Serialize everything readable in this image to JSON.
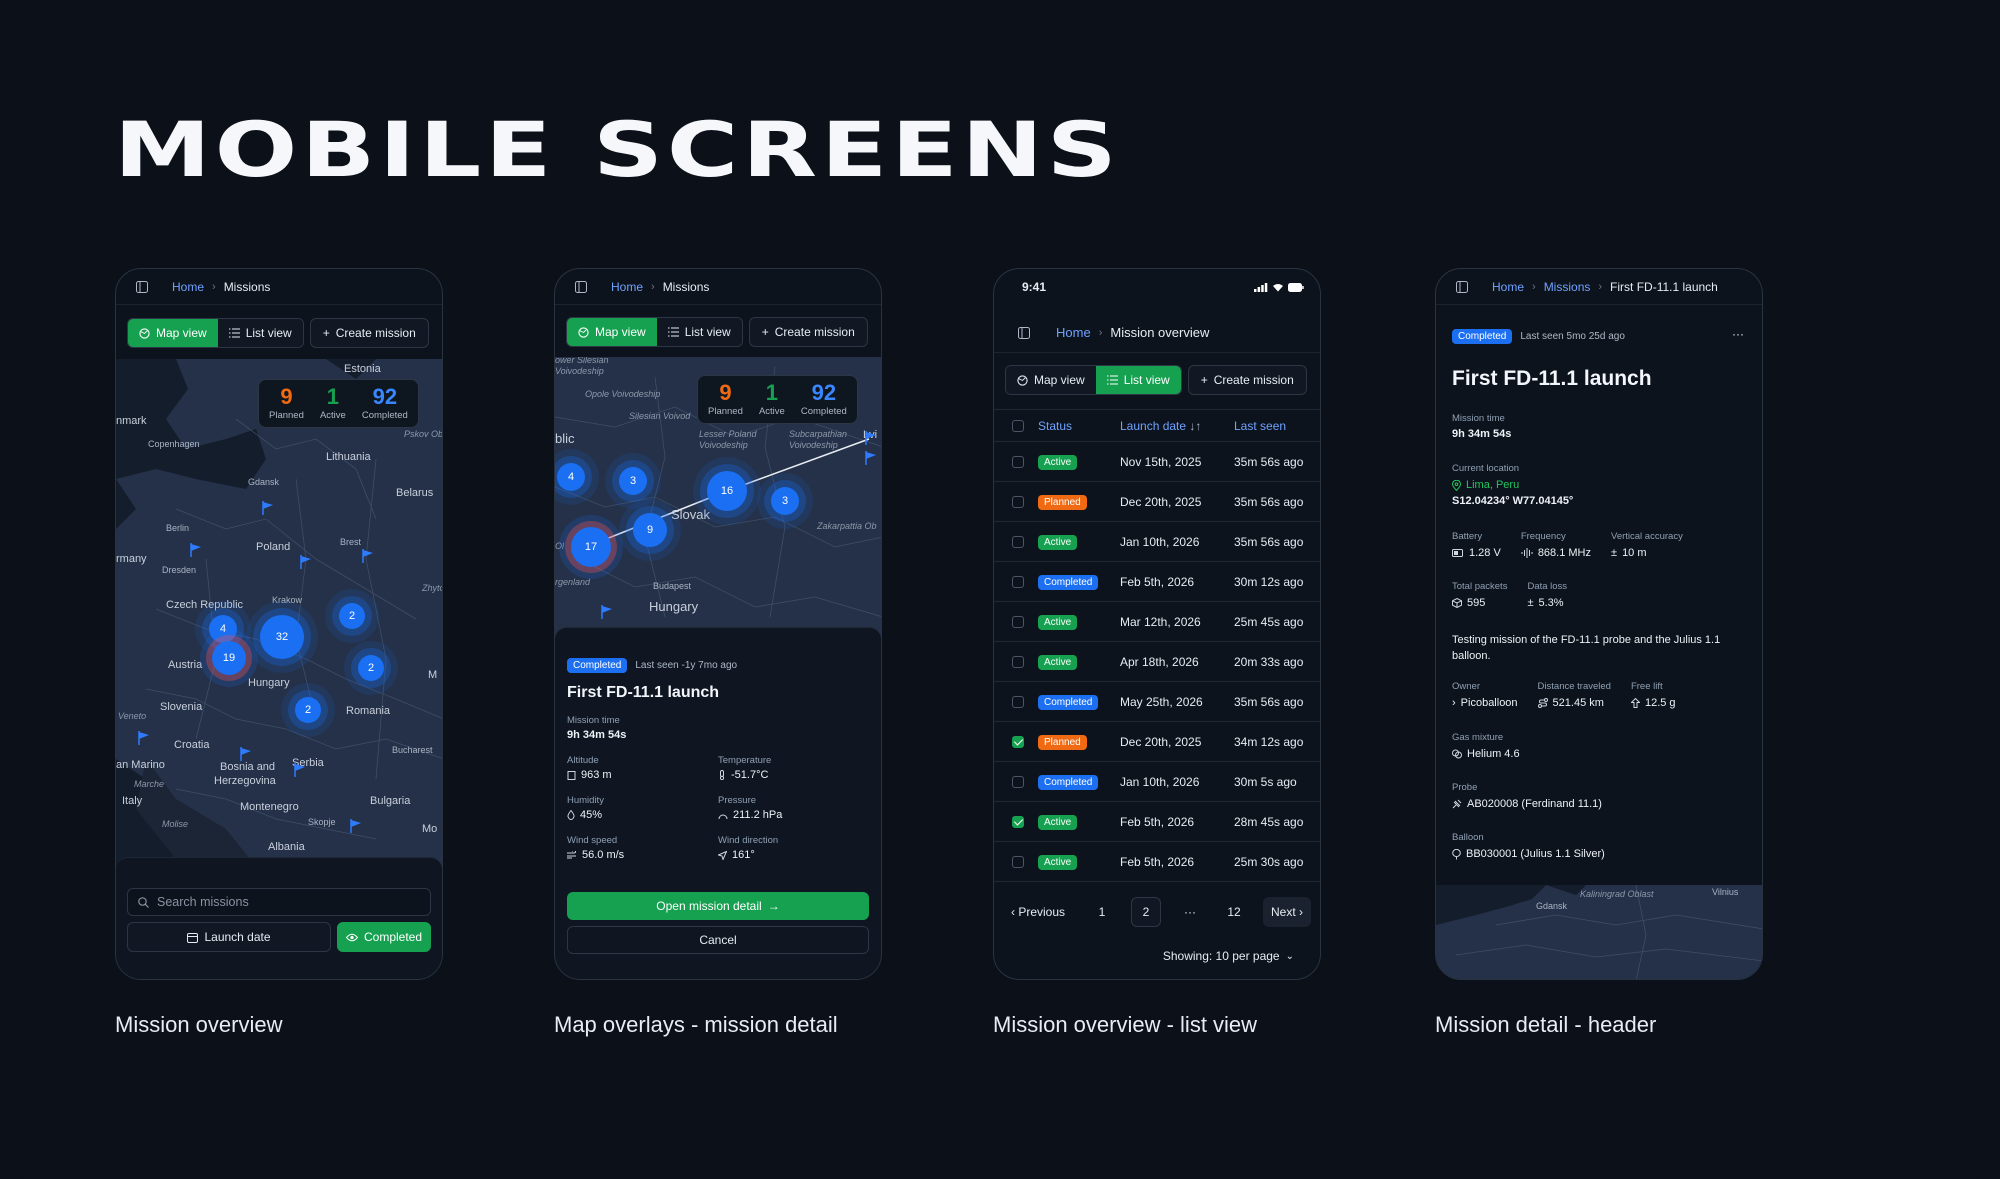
{
  "page_title": "MOBILE SCREENS",
  "captions": [
    "Mission overview",
    "Map overlays - mission detail",
    "Mission overview - list view",
    "Mission detail - header"
  ],
  "colors": {
    "green": "#16a150",
    "blue": "#1d6ff2",
    "orange": "#f06a13",
    "link": "#6fa2ff"
  },
  "breadcrumb": {
    "home": "Home",
    "missions": "Missions",
    "overview": "Mission overview",
    "launch": "First FD-11.1 launch"
  },
  "toolbar": {
    "map_view": "Map view",
    "list_view": "List view",
    "create": "Create mission"
  },
  "stats": {
    "planned_num": "9",
    "planned": "Planned",
    "active_num": "1",
    "active": "Active",
    "completed_num": "92",
    "completed": "Completed"
  },
  "screen1": {
    "labels": {
      "estonia": "Estonia",
      "denmark": "nmark",
      "copenhagen": "Copenhagen",
      "lithuania": "Lithuania",
      "gdansk": "Gdansk",
      "belarus": "Belarus",
      "berlin": "Berlin",
      "germany": "rmany",
      "poland": "Poland",
      "brest": "Brest",
      "dresden": "Dresden",
      "czech": "Czech Republic",
      "krakow": "Krakow",
      "austria": "Austria",
      "hungary": "Hungary",
      "zhyto": "Zhyto",
      "slovenia": "Slovenia",
      "romania": "Romania",
      "veneto": "Veneto",
      "croatia": "Croatia",
      "sanmarino": "an Marino",
      "bosnia1": "Bosnia and",
      "bosnia2": "Herzegovina",
      "serbia": "Serbia",
      "bucharest": "Bucharest",
      "marche": "Marche",
      "italy": "Italy",
      "montenegro": "Montenegro",
      "bulgaria": "Bulgaria",
      "molise": "Molise",
      "skopje": "Skopje",
      "albania": "Albania",
      "pskov": "Pskov Obl",
      "mi": "M",
      "mo": "Mo"
    },
    "clusters": [
      "4",
      "32",
      "19",
      "2",
      "2",
      "2"
    ],
    "search_placeholder": "Search missions",
    "launch_date": "Launch date",
    "completed": "Completed"
  },
  "screen2": {
    "labels": {
      "lower_silesian": "ower Silesian\nVoivodeship",
      "opole": "Opole Voivodeship",
      "silesian": "Silesian Voivod",
      "lesser": "Lesser Poland\nVoivodeship",
      "subcarp": "Subcarpathian\nVoivodeship",
      "lv": "Lvi",
      "public": "blic",
      "slovak": "Slovak",
      "zakarp": "Zakarpattia Ob",
      "budapest": "Budapest",
      "hungary": "Hungary",
      "genland": "rgenland",
      "ol": "Ol"
    },
    "clusters": [
      "4",
      "3",
      "16",
      "3",
      "9",
      "17"
    ],
    "badge": "Completed",
    "last_seen": "Last seen -1y 7mo ago",
    "title": "First FD-11.1 launch",
    "mission_time_label": "Mission time",
    "mission_time": "9h 34m 54s",
    "fields": [
      {
        "label": "Altitude",
        "value": "963 m",
        "icon": "ruler-icon"
      },
      {
        "label": "Temperature",
        "value": "-51.7°C",
        "icon": "thermometer-icon"
      },
      {
        "label": "Humidity",
        "value": "45%",
        "icon": "droplet-icon"
      },
      {
        "label": "Pressure",
        "value": "211.2 hPa",
        "icon": "gauge-icon"
      },
      {
        "label": "Wind speed",
        "value": "56.0 m/s",
        "icon": "wind-icon"
      },
      {
        "label": "Wind direction",
        "value": "161°",
        "icon": "navigation-icon"
      }
    ],
    "open_detail": "Open mission detail",
    "cancel": "Cancel"
  },
  "screen3": {
    "time": "9:41",
    "headers": {
      "status": "Status",
      "launch": "Launch date",
      "last_seen": "Last seen"
    },
    "rows": [
      {
        "status": "Active",
        "launch": "Nov 15th, 2025",
        "seen": "35m 56s ago",
        "checked": false
      },
      {
        "status": "Planned",
        "launch": "Dec 20th, 2025",
        "seen": "35m 56s ago",
        "checked": false
      },
      {
        "status": "Active",
        "launch": "Jan 10th, 2026",
        "seen": "35m 56s ago",
        "checked": false
      },
      {
        "status": "Completed",
        "launch": "Feb 5th, 2026",
        "seen": "30m 12s ago",
        "checked": false
      },
      {
        "status": "Active",
        "launch": "Mar 12th, 2026",
        "seen": "25m 45s ago",
        "checked": false
      },
      {
        "status": "Active",
        "launch": "Apr 18th, 2026",
        "seen": "20m 33s ago",
        "checked": false
      },
      {
        "status": "Completed",
        "launch": "May 25th, 2026",
        "seen": "35m 56s ago",
        "checked": false
      },
      {
        "status": "Planned",
        "launch": "Dec 20th, 2025",
        "seen": "34m 12s ago",
        "checked": true
      },
      {
        "status": "Completed",
        "launch": "Jan 10th, 2026",
        "seen": "30m 5s ago",
        "checked": false
      },
      {
        "status": "Active",
        "launch": "Feb 5th, 2026",
        "seen": "28m 45s ago",
        "checked": true
      },
      {
        "status": "Active",
        "launch": "Feb 5th, 2026",
        "seen": "25m 30s ago",
        "checked": false
      }
    ],
    "pager": {
      "previous": "Previous",
      "p1": "1",
      "p2": "2",
      "ellipsis": "···",
      "p12": "12",
      "next": "Next",
      "per_page": "Showing: 10 per page"
    }
  },
  "screen4": {
    "badge": "Completed",
    "last_seen": "Last seen 5mo 25d ago",
    "more": "···",
    "title": "First FD-11.1 launch",
    "mission_time_label": "Mission time",
    "mission_time": "9h 34m 54s",
    "location_label": "Current location",
    "location": "Lima, Peru",
    "coords": "S12.04234° W77.04145°",
    "battery_label": "Battery",
    "battery": "1.28 V",
    "frequency_label": "Frequency",
    "frequency": "868.1 MHz",
    "vacc_label": "Vertical accuracy",
    "vacc": "10 m",
    "packets_label": "Total packets",
    "packets": "595",
    "loss_label": "Data loss",
    "loss": "5.3%",
    "description": "Testing mission of the FD-11.1 probe and the Julius 1.1 balloon.",
    "owner_label": "Owner",
    "owner": "Picoballoon",
    "distance_label": "Distance traveled",
    "distance": "521.45 km",
    "lift_label": "Free lift",
    "lift": "12.5 g",
    "gas_label": "Gas mixture",
    "gas": "Helium 4.6",
    "probe_label": "Probe",
    "probe": "AB020008 (Ferdinand 11.1)",
    "balloon_label": "Balloon",
    "balloon": "BB030001 (Julius 1.1 Silver)",
    "map_labels": {
      "kaliningrad": "Kaliningrad Oblast",
      "vilnius": "Vilnius",
      "gdansk": "Gdansk"
    }
  }
}
